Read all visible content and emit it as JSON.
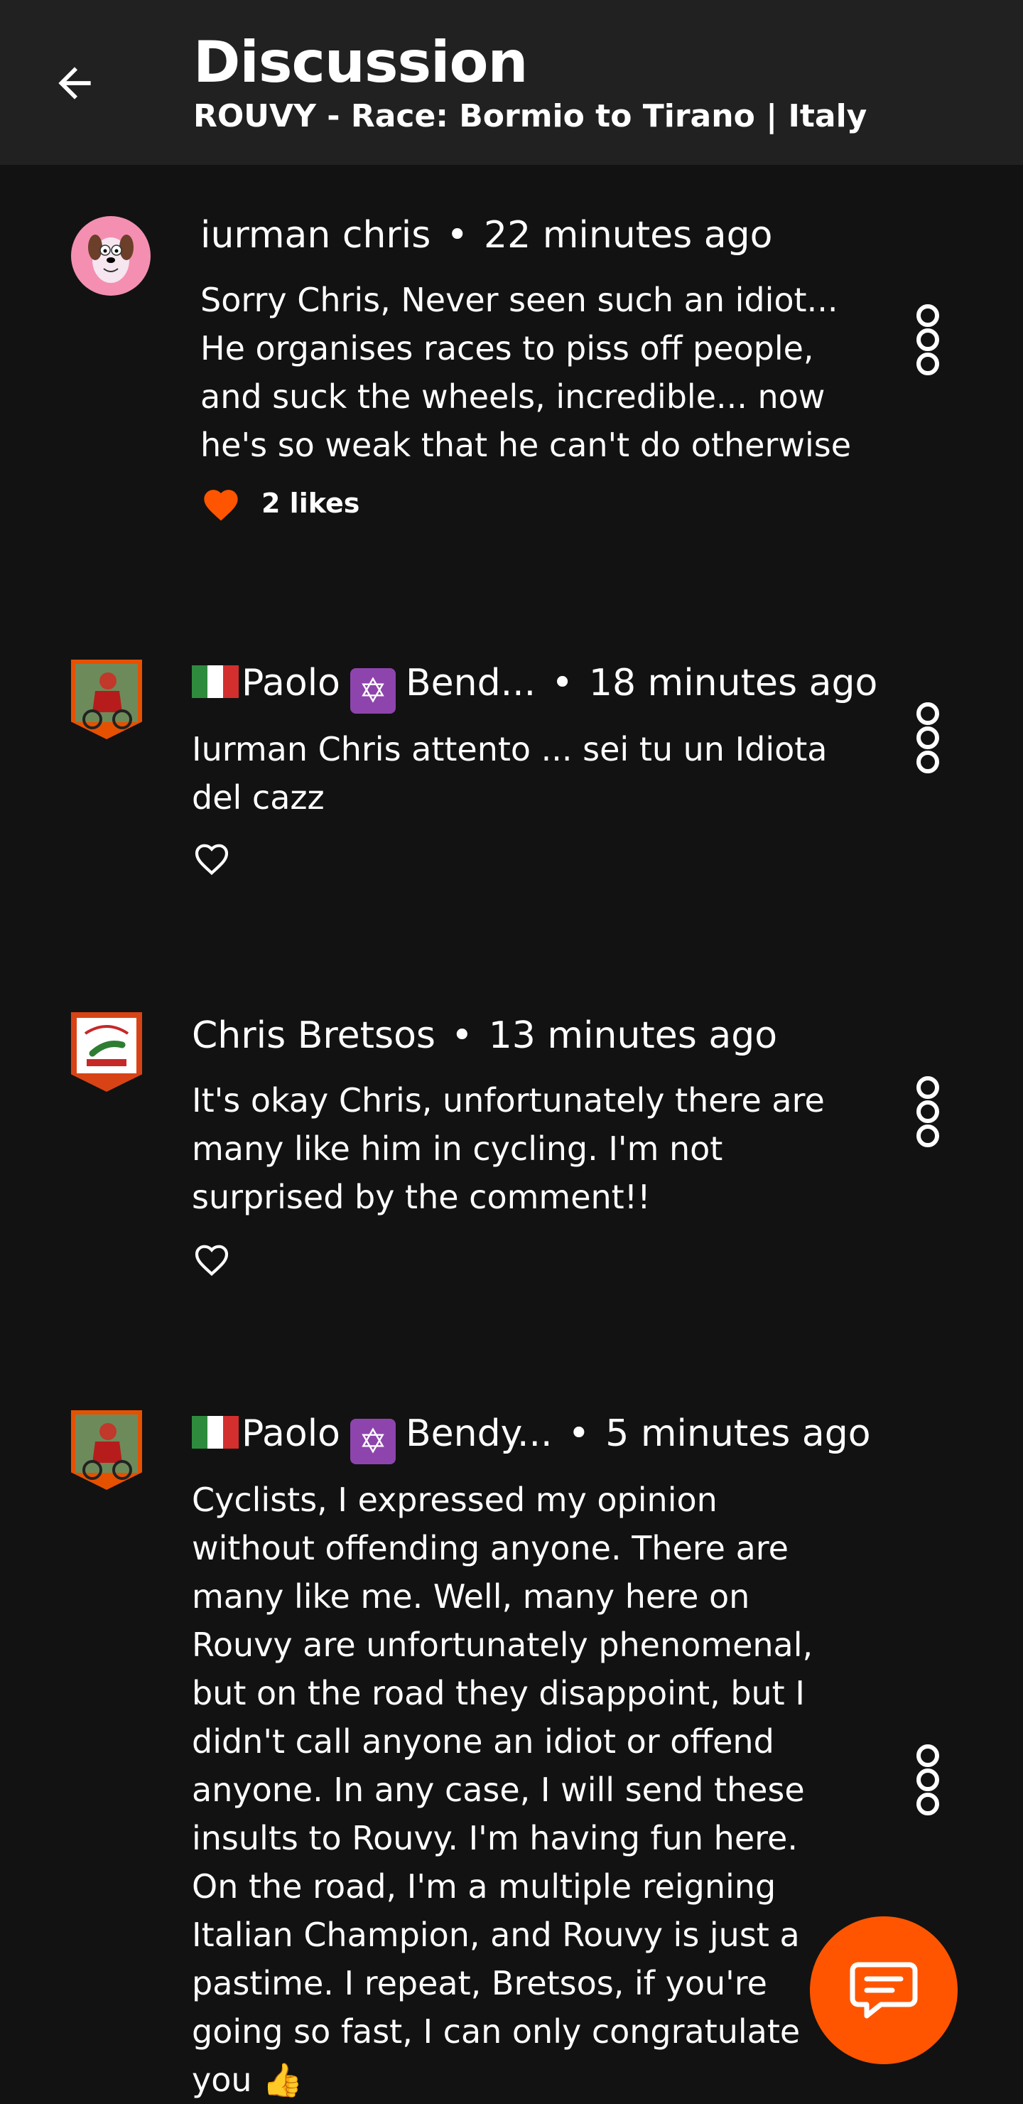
{
  "header": {
    "title": "Discussion",
    "subtitle": "ROUVY - Race: Bormio to Tirano | Italy"
  },
  "colors": {
    "background": "#121212",
    "header_bg": "#212121",
    "accent": "#ff5500",
    "like_active": "#ff5500"
  },
  "comments": [
    {
      "author": "iurman chris",
      "time": "22 minutes ago",
      "text": "Sorry Chris, Never seen such an idiot... He organises races to piss off people, and suck the wheels, incredible... now he's so weak that he can't do otherwise",
      "likes": "2 likes",
      "liked": true,
      "avatar_icon": "cartoon-dog-avatar"
    },
    {
      "author": "Paolo",
      "author_suffix": "Bend...",
      "time": "18 minutes ago",
      "text": "Iurman Chris attento ... sei tu un Idiota del cazz",
      "liked": false,
      "avatar_icon": "cyclist-photo-avatar"
    },
    {
      "author": "Chris Bretsos",
      "time": "13 minutes ago",
      "text": "It's okay Chris, unfortunately there are many like him in cycling. I'm not surprised by the comment!!",
      "liked": false,
      "avatar_icon": "team-badge-avatar"
    },
    {
      "author": "Paolo",
      "author_suffix": "Bendy...",
      "time": "5 minutes ago",
      "text": "Cyclists, I expressed my opinion without offending anyone. There are many like me. Well, many here on Rouvy are unfortunately phenomenal, but on the road they disappoint, but I didn't call anyone an idiot or offend anyone. In any case, I will send these insults to Rouvy. I'm having fun here. On the road, I'm a multiple reigning Italian Champion, and Rouvy is just a pastime. I repeat, Bretsos, if you're going so fast, I can only congratulate you 👍",
      "avatar_icon": "cyclist-photo-avatar"
    }
  ],
  "fab": {
    "icon": "chat-bubble-icon"
  }
}
